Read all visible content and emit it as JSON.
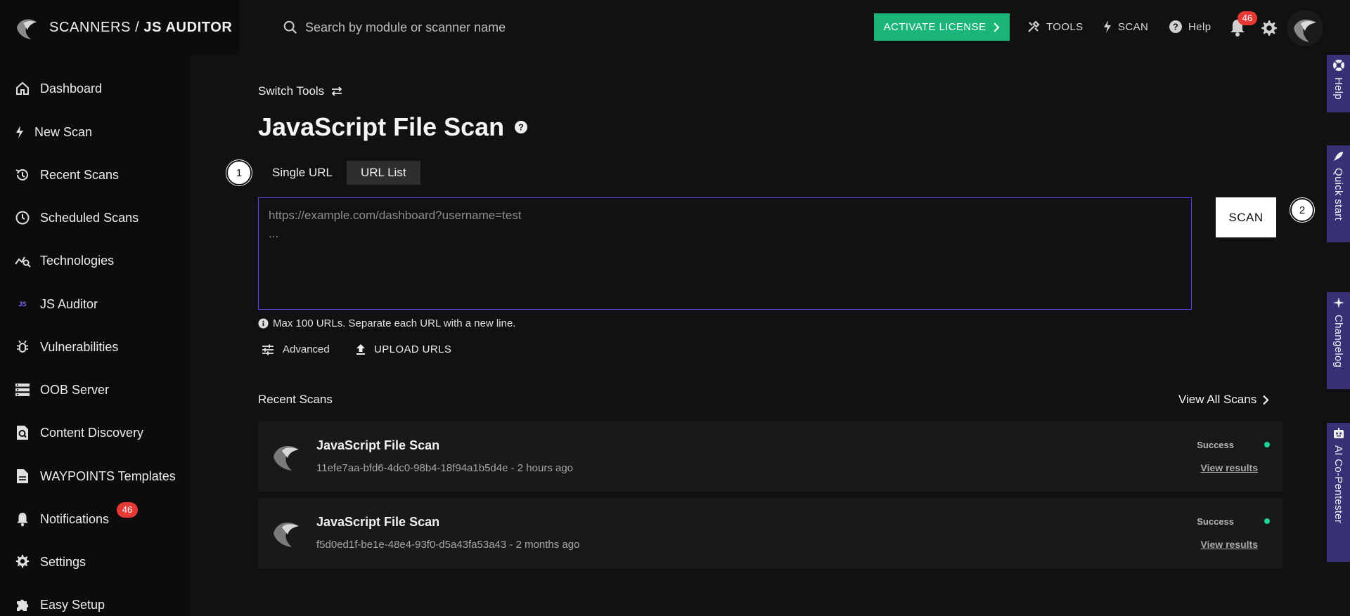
{
  "header": {
    "breadcrumb_root": "SCANNERS /",
    "breadcrumb_current": "JS AUDITOR",
    "search_placeholder": "Search by module or scanner name",
    "activate_label": "ACTIVATE LICENSE",
    "tools_label": "TOOLS",
    "scan_label": "SCAN",
    "help_label": "Help",
    "notification_count": "46"
  },
  "sidebar": {
    "items": [
      {
        "label": "Dashboard",
        "icon": "home-icon"
      },
      {
        "label": "New Scan",
        "icon": "bolt-icon"
      },
      {
        "label": "Recent Scans",
        "icon": "history-icon"
      },
      {
        "label": "Scheduled Scans",
        "icon": "clock-icon"
      },
      {
        "label": "Technologies",
        "icon": "tech-search-icon"
      },
      {
        "label": "JS Auditor",
        "icon": "js-icon"
      },
      {
        "label": "Vulnerabilities",
        "icon": "bug-icon"
      },
      {
        "label": "OOB Server",
        "icon": "server-icon"
      },
      {
        "label": "Content Discovery",
        "icon": "doc-search-icon"
      },
      {
        "label": "WAYPOINTS Templates",
        "icon": "document-icon"
      },
      {
        "label": "Notifications",
        "icon": "bell-icon"
      },
      {
        "label": "Settings",
        "icon": "gear-icon"
      },
      {
        "label": "Easy Setup",
        "icon": "puzzle-icon"
      }
    ],
    "js_icon_text": "JS",
    "notifications_badge": "46"
  },
  "main": {
    "switch_tools": "Switch Tools",
    "title": "JavaScript File Scan",
    "step1": "1",
    "step2": "2",
    "tabs": [
      {
        "label": "Single URL",
        "active": false
      },
      {
        "label": "URL List",
        "active": true
      }
    ],
    "url_placeholder": "https://example.com/dashboard?username=test\n...",
    "scan_button": "SCAN",
    "hint": "Max 100 URLs. Separate each URL with a new line.",
    "advanced_label": "Advanced",
    "upload_label": "UPLOAD URLS",
    "recent_title": "Recent Scans",
    "view_all": "View All Scans",
    "scans": [
      {
        "title": "JavaScript File Scan",
        "id": "11efe7aa-bfd6-4dc0-98b4-18f94a1b5d4e",
        "time": "2 hours ago",
        "subtitle": "11efe7aa-bfd6-4dc0-98b4-18f94a1b5d4e - 2 hours ago",
        "status": "Success",
        "link": "View results"
      },
      {
        "title": "JavaScript File Scan",
        "id": "f5d0ed1f-be1e-48e4-93f0-d5a43fa53a43",
        "time": "2 months ago",
        "subtitle": "f5d0ed1f-be1e-48e4-93f0-d5a43fa53a43 - 2 months ago",
        "status": "Success",
        "link": "View results"
      }
    ]
  },
  "rail": {
    "items": [
      {
        "label": "Help",
        "icon": "lifebuoy-icon"
      },
      {
        "label": "Quick start",
        "icon": "rocket-icon"
      },
      {
        "label": "Changelog",
        "icon": "sparkle-icon"
      },
      {
        "label": "AI Co-Pentester",
        "icon": "robot-icon"
      }
    ]
  },
  "colors": {
    "background": "#111111",
    "sidebar": "#0c0c0c",
    "accent_green": "#1bb57a",
    "accent_purple": "#5a46d6",
    "rail_purple": "#373178",
    "badge_red": "#e53935",
    "success_dot": "#1ed39a"
  }
}
